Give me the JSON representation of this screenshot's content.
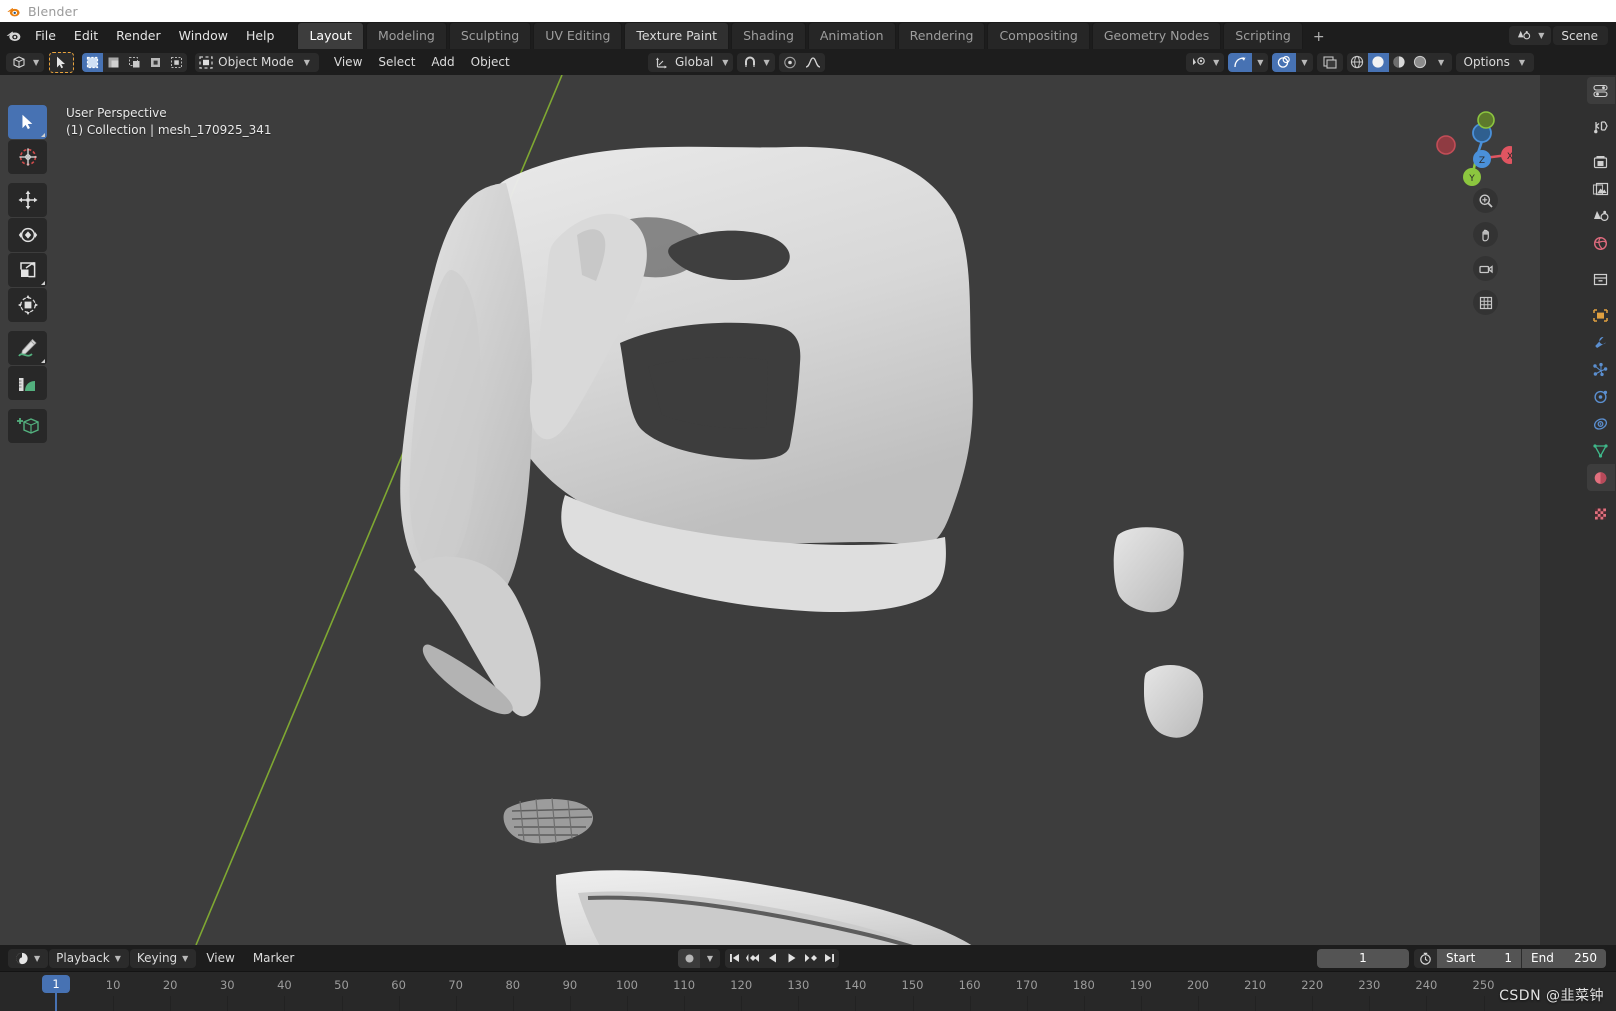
{
  "window": {
    "title": "Blender",
    "logo_icon": "blender-logo-icon"
  },
  "topbar": {
    "menus": [
      "File",
      "Edit",
      "Render",
      "Window",
      "Help"
    ],
    "workspace_tabs": [
      {
        "label": "Layout",
        "state": "active"
      },
      {
        "label": "Modeling",
        "state": "normal"
      },
      {
        "label": "Sculpting",
        "state": "normal"
      },
      {
        "label": "UV Editing",
        "state": "normal"
      },
      {
        "label": "Texture Paint",
        "state": "hover"
      },
      {
        "label": "Shading",
        "state": "normal"
      },
      {
        "label": "Animation",
        "state": "normal"
      },
      {
        "label": "Rendering",
        "state": "normal"
      },
      {
        "label": "Compositing",
        "state": "normal"
      },
      {
        "label": "Geometry Nodes",
        "state": "normal"
      },
      {
        "label": "Scripting",
        "state": "normal"
      }
    ],
    "add_workspace_label": "+",
    "scene": {
      "icon": "scene-icon",
      "name": "Scene"
    }
  },
  "viewport_header": {
    "editor_type_icon": "editor-type-3dview-icon",
    "select_modes": [
      "select-box-icon",
      "select-extend-icon",
      "select-subtract-icon",
      "select-invert-icon",
      "select-intersect-icon"
    ],
    "mode_dropdown": {
      "icon": "object-mode-icon",
      "label": "Object Mode"
    },
    "menus": [
      "View",
      "Select",
      "Add",
      "Object"
    ],
    "transform_orientation": {
      "icon": "orientation-icon",
      "label": "Global"
    },
    "snap": {
      "icon": "snap-magnet-icon",
      "target_icon": "snap-target-icon"
    },
    "proportional_editing": {
      "icon": "proportional-edit-icon",
      "falloff_icon": "falloff-smooth-icon"
    },
    "right": {
      "visibility_icon": "object-visibility-icon",
      "gizmo_icon": "show-gizmo-icon",
      "overlays_icon": "show-overlays-icon",
      "xray_icon": "toggle-xray-icon",
      "shading_modes": [
        {
          "icon": "shading-wireframe-icon",
          "active": false
        },
        {
          "icon": "shading-solid-icon",
          "active": true
        },
        {
          "icon": "shading-material-icon",
          "active": false
        },
        {
          "icon": "shading-rendered-icon",
          "active": false
        }
      ],
      "options_label": "Options"
    }
  },
  "viewport": {
    "overlay_line1": "User Perspective",
    "overlay_line2": "(1) Collection | mesh_170925_341",
    "background_color": "#3d3d3d",
    "mesh_color": "#e4e4e4",
    "tools": [
      {
        "name": "tweak-select-tool",
        "icon": "cursor-arrow-icon",
        "active": true
      },
      {
        "name": "cursor-tool",
        "icon": "3d-cursor-icon",
        "active": false
      },
      {
        "name": "move-tool",
        "icon": "move-arrows-icon",
        "active": false
      },
      {
        "name": "rotate-tool",
        "icon": "rotate-icon",
        "active": false
      },
      {
        "name": "scale-tool",
        "icon": "scale-icon",
        "active": false
      },
      {
        "name": "transform-tool",
        "icon": "transform-icon",
        "active": false
      },
      {
        "name": "annotate-tool",
        "icon": "pencil-icon",
        "active": false
      },
      {
        "name": "measure-tool",
        "icon": "ruler-icon",
        "active": false
      },
      {
        "name": "add-cube-tool",
        "icon": "add-cube-icon",
        "active": false
      }
    ],
    "gizmo": {
      "axis_x_label": "X",
      "axis_y_label": "Y",
      "axis_z_label": "Z",
      "color_x": "#e05561",
      "color_y": "#8cc63f",
      "color_z": "#4a90d9"
    },
    "nav_buttons": [
      "zoom-icon",
      "pan-hand-icon",
      "camera-icon",
      "ortho-persp-icon"
    ]
  },
  "properties": {
    "tabs": [
      {
        "name": "tool-properties-tab",
        "icon": "tool-icon",
        "active": true
      },
      {
        "name": "render-properties-tab",
        "icon": "camera-back-icon",
        "active": false
      },
      {
        "name": "output-properties-tab",
        "icon": "printer-icon",
        "active": false
      },
      {
        "name": "view-layer-properties-tab",
        "icon": "images-icon",
        "active": false
      },
      {
        "name": "scene-properties-tab",
        "icon": "scene-cone-icon",
        "active": false
      },
      {
        "name": "world-properties-tab",
        "icon": "world-globe-icon",
        "active": false
      },
      {
        "name": "collection-properties-tab",
        "icon": "collection-box-icon",
        "active": false
      },
      {
        "name": "object-properties-tab",
        "icon": "object-square-icon",
        "active": false
      },
      {
        "name": "modifier-properties-tab",
        "icon": "wrench-icon",
        "active": false
      },
      {
        "name": "particle-properties-tab",
        "icon": "particles-icon",
        "active": false
      },
      {
        "name": "physics-properties-tab",
        "icon": "physics-orbit-icon",
        "active": false
      },
      {
        "name": "constraint-properties-tab",
        "icon": "constraint-icon",
        "active": false
      },
      {
        "name": "data-properties-tab",
        "icon": "mesh-data-icon",
        "active": false
      },
      {
        "name": "material-properties-tab",
        "icon": "material-sphere-icon",
        "active": true
      },
      {
        "name": "texture-properties-tab",
        "icon": "texture-checker-icon",
        "active": false
      }
    ]
  },
  "timeline": {
    "editor_icon": "editor-type-timeline-icon",
    "menus": [
      {
        "label": "Playback",
        "dropdown": true
      },
      {
        "label": "Keying",
        "dropdown": true
      },
      {
        "label": "View",
        "dropdown": false
      },
      {
        "label": "Marker",
        "dropdown": false
      }
    ],
    "record_icon": "auto-keying-record-icon",
    "transport": [
      "jump-to-start-icon",
      "jump-to-prev-keyframe-icon",
      "play-reverse-icon",
      "play-icon",
      "jump-to-next-keyframe-icon",
      "jump-to-end-icon"
    ],
    "current_frame": "1",
    "use_preview_range_icon": "stopwatch-icon",
    "start_label": "Start",
    "start_value": "1",
    "end_label": "End",
    "end_value": "250",
    "ruler_ticks": [
      "10",
      "20",
      "30",
      "40",
      "50",
      "60",
      "70",
      "80",
      "90",
      "100",
      "110",
      "120",
      "130",
      "140",
      "150",
      "160",
      "170",
      "180",
      "190",
      "200",
      "210",
      "220",
      "230",
      "240",
      "250"
    ],
    "playhead_frame": "1"
  },
  "watermark": {
    "text": "CSDN @韭菜钟"
  }
}
